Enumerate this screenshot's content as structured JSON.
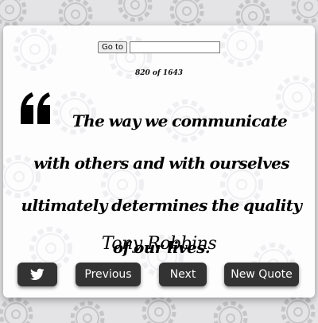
{
  "goto": {
    "button_label": "Go to",
    "input_value": "",
    "input_placeholder": ""
  },
  "counter": {
    "current": "820",
    "separator": "of",
    "total": "1643",
    "display": "820 of 1643"
  },
  "quote": {
    "text": "The way we communicate with others and with ourselves ultimately determines the quality of our lives.",
    "author": "Tony Robbins"
  },
  "buttons": {
    "tweet_icon": "twitter-bird-icon",
    "previous_label": "Previous",
    "next_label": "Next",
    "new_quote_label": "New Quote"
  },
  "colors": {
    "button_bg": "#333333",
    "button_text": "#ffffff",
    "page_bg": "#e4e4e6",
    "gear_pattern": "#c9c9cc"
  }
}
